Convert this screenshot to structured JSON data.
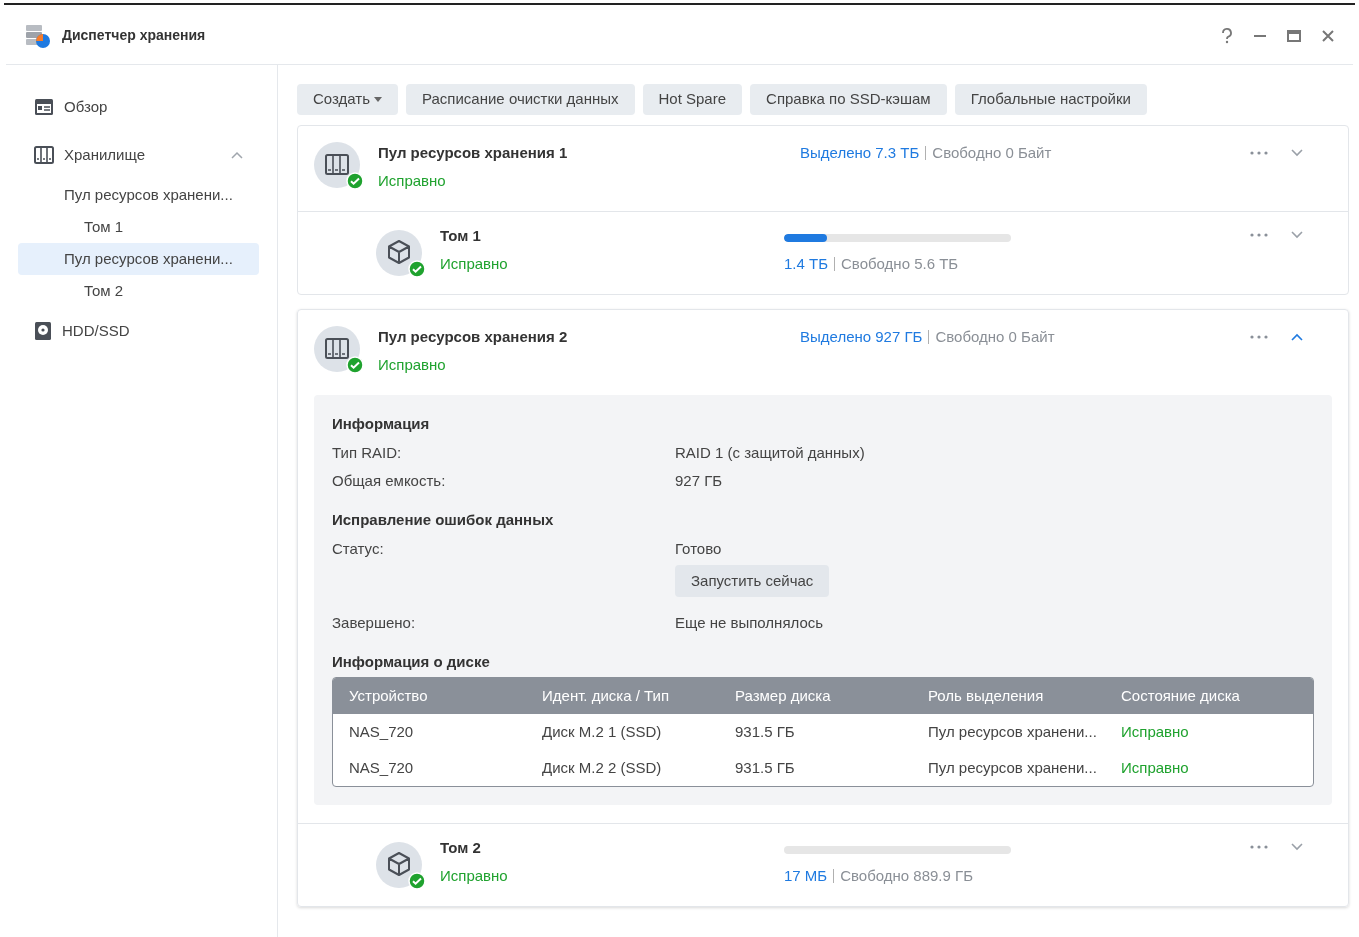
{
  "window": {
    "title": "Диспетчер хранения"
  },
  "sidebar": {
    "items": [
      {
        "label": "Обзор",
        "kind": "overview",
        "selected": false
      },
      {
        "label": "Хранилище",
        "kind": "storage",
        "selected": false,
        "expanded": true,
        "children": [
          {
            "label": "Пул ресурсов хранени...",
            "selected": false,
            "children": [
              {
                "label": "Том 1",
                "selected": false
              }
            ]
          },
          {
            "label": "Пул ресурсов хранени...",
            "selected": true,
            "children": [
              {
                "label": "Том 2",
                "selected": false
              }
            ]
          }
        ]
      },
      {
        "label": "HDD/SSD",
        "kind": "disk",
        "selected": false
      }
    ]
  },
  "toolbar": [
    {
      "label": "Создать",
      "kind": "dropdown"
    },
    {
      "label": "Расписание очистки данных",
      "kind": "button"
    },
    {
      "label": "Hot Spare",
      "kind": "button"
    },
    {
      "label": "Справка по SSD-кэшам",
      "kind": "button"
    },
    {
      "label": "Глобальные настройки",
      "kind": "button"
    }
  ],
  "pools": [
    {
      "name": "Пул ресурсов хранения 1",
      "status": "Исправно",
      "allocated": "Выделено 7.3 ТБ",
      "free": "Свободно 0 Байт",
      "expanded": false,
      "volume": {
        "name": "Том 1",
        "status": "Исправно",
        "level": 0.19,
        "used": "1.4 ТБ",
        "free": "Свободно 5.6 ТБ"
      }
    },
    {
      "name": "Пул ресурсов хранения 2",
      "status": "Исправно",
      "allocated": "Выделено 927 ГБ",
      "free": "Свободно 0 Байт",
      "expanded": true,
      "details": {
        "sections": [
          {
            "title": "Информация",
            "rows": [
              {
                "kind": "text",
                "label": "Тип RAID:",
                "value": "RAID 1 (с защитой данных)"
              },
              {
                "kind": "text",
                "label": "Общая емкость:",
                "value": "927 ГБ"
              }
            ]
          },
          {
            "title": "Исправление ошибок данных",
            "rows": [
              {
                "kind": "text",
                "label": "Статус:",
                "value": "Готово"
              },
              {
                "kind": "button",
                "value": "Запустить сейчас"
              },
              {
                "kind": "text",
                "label": "Завершено:",
                "value": "Еще не выполнялось"
              }
            ]
          }
        ],
        "disk_table": {
          "title": "Информация о диске",
          "columns": [
            "Устройство",
            "Идент. диска / Тип",
            "Размер диска",
            "Роль выделения",
            "Состояние диска"
          ],
          "rows": [
            [
              "NAS_720",
              "Диск M.2 1 (SSD)",
              "931.5 ГБ",
              "Пул ресурсов хранени...",
              "Исправно"
            ],
            [
              "NAS_720",
              "Диск M.2 2 (SSD)",
              "931.5 ГБ",
              "Пул ресурсов хранени...",
              "Исправно"
            ]
          ]
        }
      },
      "volume": {
        "name": "Том 2",
        "status": "Исправно",
        "used": "17 МБ",
        "free": "Свободно 889.9 ГБ"
      }
    }
  ]
}
